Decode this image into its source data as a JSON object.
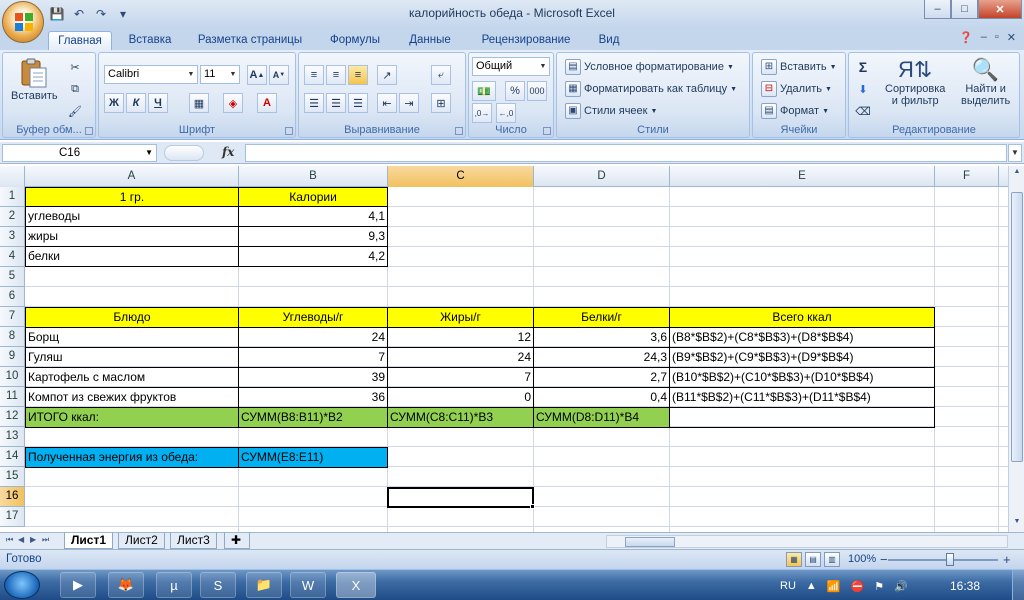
{
  "window": {
    "title": "калорийность обеда - Microsoft Excel",
    "minimize": "–",
    "maximize": "□",
    "close": "✕"
  },
  "qat": {
    "save": "💾",
    "undo": "↶",
    "redo": "↷",
    "customize": "▾"
  },
  "tabs": [
    "Главная",
    "Вставка",
    "Разметка страницы",
    "Формулы",
    "Данные",
    "Рецензирование",
    "Вид"
  ],
  "ribbon": {
    "clipboard": {
      "label": "Буфер обм...",
      "paste": "Вставить"
    },
    "font": {
      "label": "Шрифт",
      "name": "Calibri",
      "size": "11",
      "bold": "Ж",
      "italic": "К",
      "underline": "Ч"
    },
    "alignment": {
      "label": "Выравнивание"
    },
    "number": {
      "label": "Число",
      "format": "Общий"
    },
    "styles": {
      "label": "Стили",
      "conditional": "Условное форматирование",
      "table": "Форматировать как таблицу",
      "cell_styles": "Стили ячеек"
    },
    "cells": {
      "label": "Ячейки",
      "insert": "Вставить",
      "delete": "Удалить",
      "format": "Формат"
    },
    "editing": {
      "label": "Редактирование",
      "sort": "Сортировка\nи фильтр",
      "find": "Найти и\nвыделить"
    }
  },
  "formula_bar": {
    "name_box": "C16",
    "fx": "fx",
    "formula": ""
  },
  "columns": [
    "A",
    "B",
    "C",
    "D",
    "E",
    "F"
  ],
  "rows": [
    "1",
    "2",
    "3",
    "4",
    "5",
    "6",
    "7",
    "8",
    "9",
    "10",
    "11",
    "12",
    "13",
    "14",
    "15",
    "16",
    "17"
  ],
  "cells": {
    "A1": "1 гр.",
    "B1": "Калории",
    "A2": "углеводы",
    "B2": "4,1",
    "A3": "жиры",
    "B3": "9,3",
    "A4": "белки",
    "B4": "4,2",
    "A7": "Блюдо",
    "B7": "Углеводы/г",
    "C7": "Жиры/г",
    "D7": "Белки/г",
    "E7": "Всего ккал",
    "A8": "Борщ",
    "B8": "24",
    "C8": "12",
    "D8": "3,6",
    "E8": "(B8*$B$2)+(C8*$B$3)+(D8*$B$4)",
    "A9": "Гуляш",
    "B9": "7",
    "C9": "24",
    "D9": "24,3",
    "E9": "(B9*$B$2)+(C9*$B$3)+(D9*$B$4)",
    "A10": "Картофель с маслом",
    "B10": "39",
    "C10": "7",
    "D10": "2,7",
    "E10": "(B10*$B$2)+(C10*$B$3)+(D10*$B$4)",
    "A11": "Компот из свежих фруктов",
    "B11": "36",
    "C11": "0",
    "D11": "0,4",
    "E11": "(B11*$B$2)+(C11*$B$3)+(D11*$B$4)",
    "A12": "ИТОГО ккал:",
    "B12": "СУММ(B8:B11)*B2",
    "C12": "СУММ(C8:C11)*B3",
    "D12": "СУММ(D8:D11)*B4",
    "A14": "Полученная энергия из обеда:",
    "B14": "СУММ(E8:E11)"
  },
  "sheets": [
    "Лист1",
    "Лист2",
    "Лист3"
  ],
  "status": {
    "ready": "Готово",
    "zoom": "100%"
  },
  "taskbar": {
    "lang": "RU",
    "time": "16:38"
  },
  "colors": {
    "yellow": "#ffff00",
    "green": "#92d050",
    "blue": "#00b0f0",
    "selected_header": "#f1c15f"
  }
}
